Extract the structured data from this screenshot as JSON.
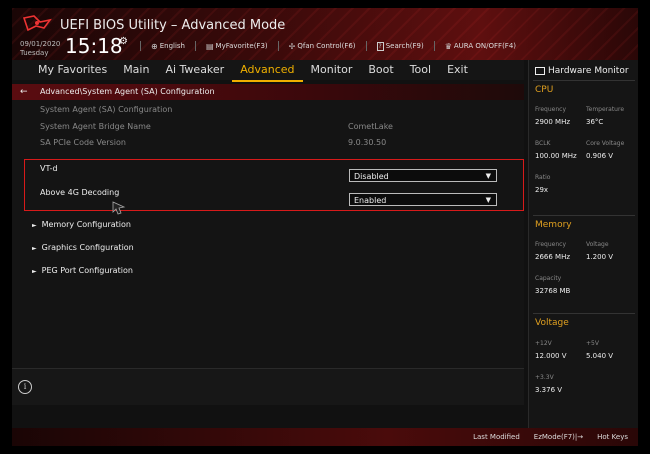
{
  "header": {
    "title": "UEFI BIOS Utility – Advanced Mode",
    "date": "09/01/2020",
    "day": "Tuesday",
    "time": "15:18",
    "items": [
      {
        "icon": "globe-icon",
        "glyph": "⊕",
        "label": "English"
      },
      {
        "icon": "favorite-icon",
        "glyph": "▤",
        "label": "MyFavorite(F3)"
      },
      {
        "icon": "fan-icon",
        "glyph": "✢",
        "label": "Qfan Control(F6)"
      },
      {
        "icon": "search-icon",
        "glyph": "?",
        "label": "Search(F9)"
      },
      {
        "icon": "aura-icon",
        "glyph": "♛",
        "label": "AURA ON/OFF(F4)"
      }
    ]
  },
  "menu": {
    "tabs": [
      "My Favorites",
      "Main",
      "Ai Tweaker",
      "Advanced",
      "Monitor",
      "Boot",
      "Tool",
      "Exit"
    ],
    "active": "Advanced"
  },
  "breadcrumb": "Advanced\\System Agent (SA) Configuration",
  "settings": {
    "info_rows": [
      {
        "label": "System Agent (SA) Configuration",
        "value": ""
      },
      {
        "label": "System Agent Bridge Name",
        "value": "CometLake"
      },
      {
        "label": "SA PCIe Code Version",
        "value": "9.0.30.50"
      }
    ],
    "vtd": {
      "label": "VT-d",
      "value": "Disabled"
    },
    "above4g": {
      "label": "Above 4G Decoding",
      "value": "Enabled"
    },
    "submenus": [
      "Memory Configuration",
      "Graphics Configuration",
      "PEG Port Configuration"
    ]
  },
  "footer": {
    "items": [
      "Last Modified",
      "EzMode(F7)|→",
      "Hot Keys"
    ]
  },
  "hardware_monitor": {
    "title": "Hardware Monitor",
    "cpu": {
      "section": "CPU",
      "frequency_label": "Frequency",
      "frequency": "2900 MHz",
      "temperature_label": "Temperature",
      "temperature": "36°C",
      "bclk_label": "BCLK",
      "bclk": "100.00 MHz",
      "core_voltage_label": "Core Voltage",
      "core_voltage": "0.906 V",
      "ratio_label": "Ratio",
      "ratio": "29x"
    },
    "memory": {
      "section": "Memory",
      "frequency_label": "Frequency",
      "frequency": "2666 MHz",
      "voltage_label": "Voltage",
      "voltage": "1.200 V",
      "capacity_label": "Capacity",
      "capacity": "32768 MB"
    },
    "voltage": {
      "section": "Voltage",
      "v12_label": "+12V",
      "v12": "12.000 V",
      "v5_label": "+5V",
      "v5": "5.040 V",
      "v33_label": "+3.3V",
      "v33": "3.376 V"
    }
  }
}
